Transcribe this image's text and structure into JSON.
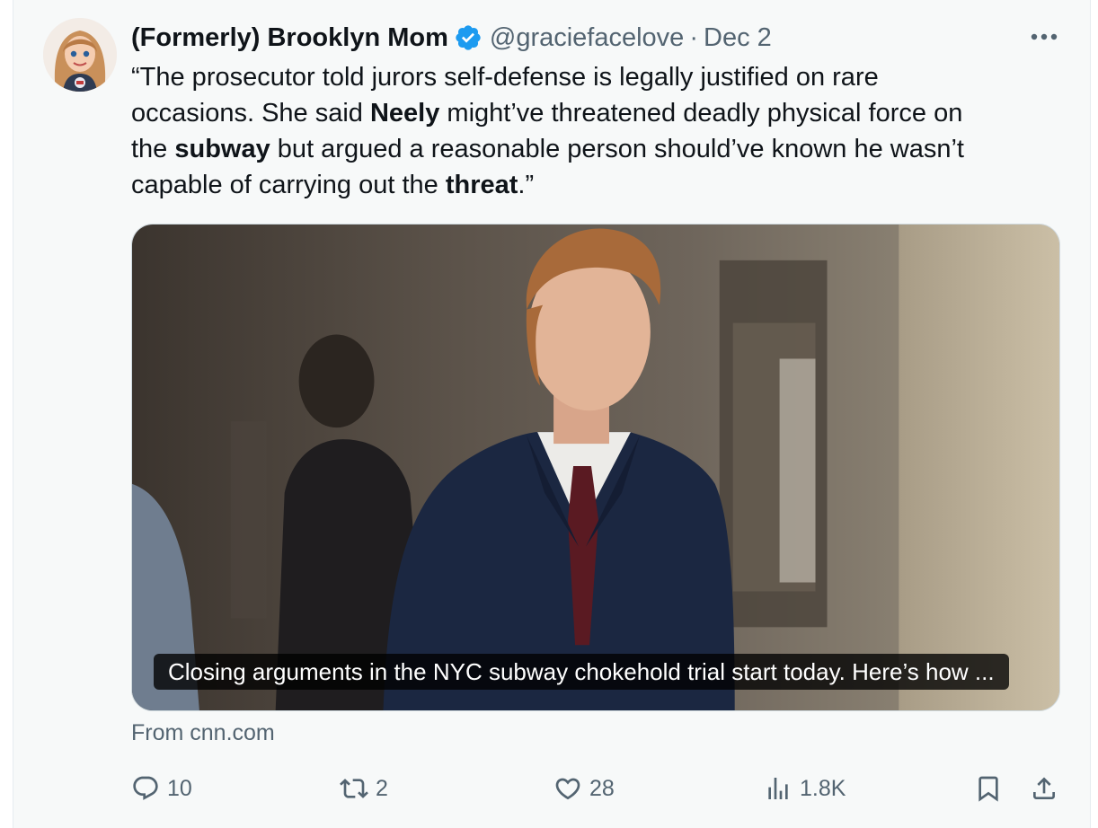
{
  "tweet": {
    "author_name": "(Formerly) Brooklyn Mom",
    "handle": "@graciefacelove",
    "separator": "·",
    "date": "Dec 2",
    "verified": true,
    "text": {
      "l1": "“The prosecutor told jurors self-defense is legally justified on rare",
      "l2_a": "occasions. She said ",
      "l2_b": "Neely",
      "l2_c": " might’ve threatened deadly physical force on",
      "l3_a": "the ",
      "l3_b": "subway",
      "l3_c": " but argued a reasonable person should’ve known he wasn’t",
      "l4_a": "capable of carrying out the ",
      "l4_b": "threat",
      "l4_c": ".”"
    },
    "card": {
      "caption": "Closing arguments in the NYC subway chokehold trial start today. Here’s how ...",
      "source": "From cnn.com"
    },
    "actions": {
      "replies": "10",
      "reposts": "2",
      "likes": "28",
      "views": "1.8K"
    }
  },
  "icons": [
    "verified-badge-icon",
    "more-icon",
    "reply-icon",
    "repost-icon",
    "like-icon",
    "views-icon",
    "bookmark-icon",
    "share-icon"
  ],
  "colors": {
    "verified": "#1d9bf0",
    "text_primary": "#0f1419",
    "text_secondary": "#536471",
    "background": "#f7f9f9"
  }
}
